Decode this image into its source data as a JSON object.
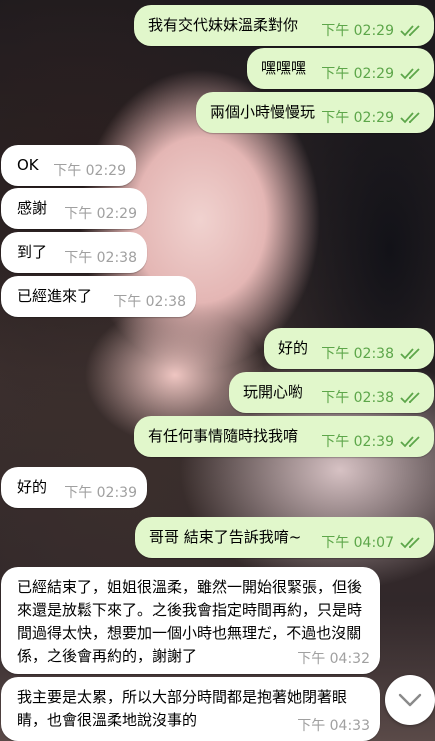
{
  "colors": {
    "outgoing_bubble": "#e1f7cb",
    "incoming_bubble": "#ffffff",
    "outgoing_time": "#5da64a",
    "incoming_time": "#a0a0a0",
    "read_ticks": "#5da64a"
  },
  "messages": [
    {
      "side": "out",
      "text": "我有交代妹妹溫柔對你",
      "time": "下午 02:29",
      "status": "read"
    },
    {
      "side": "out",
      "text": "嘿嘿嘿",
      "time": "下午 02:29",
      "status": "read"
    },
    {
      "side": "out",
      "text": "兩個小時慢慢玩",
      "time": "下午 02:29",
      "status": "read"
    },
    {
      "side": "in",
      "text": "OK",
      "time": "下午 02:29"
    },
    {
      "side": "in",
      "text": "感謝",
      "time": "下午 02:29"
    },
    {
      "side": "in",
      "text": "到了",
      "time": "下午 02:38"
    },
    {
      "side": "in",
      "text": "已經進來了",
      "time": "下午 02:38"
    },
    {
      "side": "out",
      "text": "好的",
      "time": "下午 02:38",
      "status": "read"
    },
    {
      "side": "out",
      "text": "玩開心喲",
      "time": "下午 02:38",
      "status": "read"
    },
    {
      "side": "out",
      "text": "有任何事情隨時找我唷",
      "time": "下午 02:39",
      "status": "read"
    },
    {
      "side": "in",
      "text": "好的",
      "time": "下午 02:39"
    },
    {
      "side": "out",
      "text": "哥哥 結束了告訴我唷~",
      "time": "下午 04:07",
      "status": "read"
    },
    {
      "side": "in",
      "text": "已經結束了，姐姐很溫柔，雖然一開始很緊張，但後來還是放鬆下來了。之後我會指定時間再約，只是時間過得太快，想要加一個小時也無理だ，不過也沒關係，之後會再約的，謝謝了",
      "time": "下午 04:32"
    },
    {
      "side": "in",
      "text": "我主要是太累，所以大部分時間都是抱著她閉著眼睛，也會很溫柔地說沒事的",
      "time": "下午 04:33"
    }
  ],
  "scroll_button": {
    "icon": "chevron-down-icon"
  }
}
